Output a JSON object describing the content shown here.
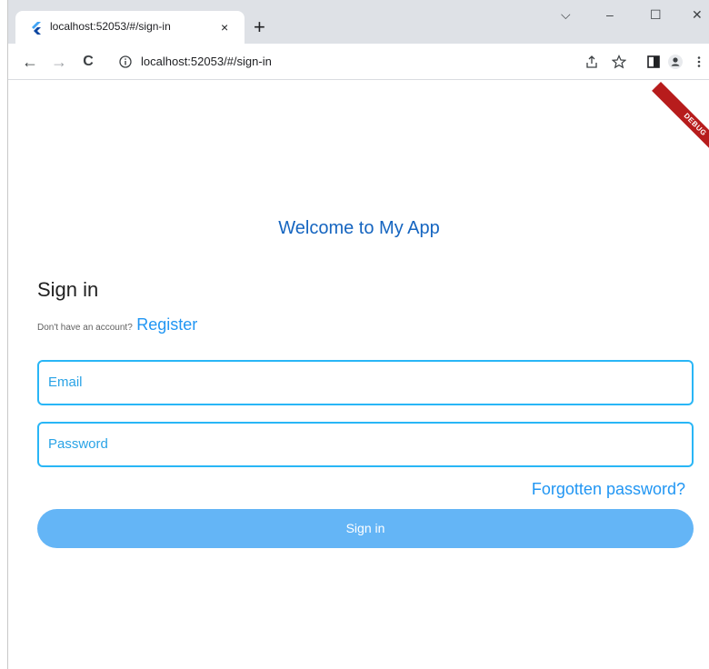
{
  "browser": {
    "tab": {
      "title": "localhost:52053/#/sign-in",
      "close": "×"
    },
    "new_tab": "+",
    "window_controls": {
      "tab_search": "⌵",
      "minimize": "–",
      "maximize": "☐",
      "close": "✕"
    },
    "nav": {
      "back": "←",
      "forward": "→",
      "reload": "C"
    },
    "url": "localhost:52053/#/sign-in",
    "debug_banner": "DEBUG"
  },
  "app": {
    "welcome": "Welcome to My App",
    "heading": "Sign in",
    "register_prompt": "Don't have an account?",
    "register_link": "Register",
    "email_label": "Email",
    "password_label": "Password",
    "forgot_link": "Forgotten password?",
    "submit_label": "Sign in"
  },
  "icons": [
    "flutter-favicon-icon",
    "info-icon",
    "share-icon",
    "star-icon",
    "side-panel-icon",
    "profile-icon",
    "kebab-menu-icon"
  ],
  "colors": {
    "accent": "#2196f3",
    "title": "#1565c0",
    "field_border": "#29b6f6",
    "button": "#64b5f6",
    "debug": "#b71c1c"
  }
}
